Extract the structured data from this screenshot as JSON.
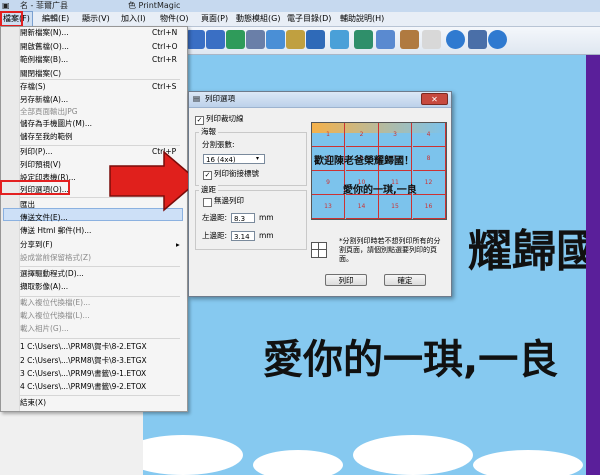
{
  "window": {
    "title_left": "名 - 菲爾广县",
    "title_app": "色 PrintMagic"
  },
  "menubar": [
    "檔案(F)",
    "編輯(E)",
    "顯示(V)",
    "加入(I)",
    "物件(O)",
    "頁面(P)",
    "動態模組(G)",
    "電子目錄(D)",
    "輔助說明(H)"
  ],
  "file_menu": {
    "items": [
      {
        "label": "開新檔案(N)...",
        "shortcut": "Ctrl+N"
      },
      {
        "label": "開啟舊檔(O)...",
        "shortcut": "Ctrl+O"
      },
      {
        "label": "範例檔案(B)...",
        "shortcut": "Ctrl+R"
      },
      {
        "label": "關閉檔案(C)",
        "shortcut": ""
      },
      {
        "label": "存檔(S)",
        "shortcut": "Ctrl+S"
      },
      {
        "label": "另存新檔(A)...",
        "shortcut": ""
      },
      {
        "label": "全部頁面輸出JPG",
        "shortcut": ""
      },
      {
        "label": "儲存為手機圖片(M)...",
        "shortcut": ""
      },
      {
        "label": "儲存至我的範例",
        "shortcut": ""
      },
      {
        "label": "列印(P)...",
        "shortcut": "Ctrl+P"
      },
      {
        "label": "列印預視(V)",
        "shortcut": ""
      },
      {
        "label": "設定印表機(R)...",
        "shortcut": ""
      },
      {
        "label": "列印選項(O)...",
        "shortcut": ""
      },
      {
        "label": "匯出",
        "shortcut": ""
      },
      {
        "label": "傳送文件(E)...",
        "shortcut": ""
      },
      {
        "label": "傳送 Html 郵件(H)...",
        "shortcut": ""
      },
      {
        "label": "分享到(F)",
        "shortcut": "▸"
      },
      {
        "label": "設成當前保留格式(Z)",
        "shortcut": ""
      },
      {
        "label": "選擇驅動程式(D)...",
        "shortcut": ""
      },
      {
        "label": "擷取影像(A)...",
        "shortcut": ""
      },
      {
        "label": "載入複位代換檔(E)...",
        "shortcut": ""
      },
      {
        "label": "載入複位代換檔(L)...",
        "shortcut": ""
      },
      {
        "label": "載入相片(G)...",
        "shortcut": ""
      },
      {
        "label": "1 C:\\Users\\...\\PRM8\\賀卡\\8-2.ETGX",
        "shortcut": ""
      },
      {
        "label": "2 C:\\Users\\...\\PRM8\\賀卡\\8-3.ETGX",
        "shortcut": ""
      },
      {
        "label": "3 C:\\Users\\...\\PRM9\\書籤\\9-1.ETOX",
        "shortcut": ""
      },
      {
        "label": "4 C:\\Users\\...\\PRM9\\書籤\\9-2.ETOX",
        "shortcut": ""
      },
      {
        "label": "結束(X)",
        "shortcut": ""
      }
    ]
  },
  "dialog": {
    "title": "列印選項",
    "close": "✕",
    "print_crop_marks": "列印裁切線",
    "poster_group": "海報",
    "split_label": "分割張數:",
    "split_value": "16 (4x4)",
    "print_joint_marks": "列印銜接標號",
    "margin_group": "邊距",
    "borderless": "無邊列印",
    "left_margin_label": "左邊距:",
    "left_margin_value": "8.3",
    "top_margin_label": "上邊距:",
    "top_margin_value": "3.14",
    "unit": "mm",
    "note": "*分割列印時若不想列印所有的分割頁面，請個別點選要列印的頁面。",
    "print_button": "列印",
    "ok_button": "確定",
    "preview_title": "歡迎陳老爸榮耀歸國！",
    "preview_sub": "愛你的一琪,一良",
    "preview_numbers": [
      "1",
      "2",
      "3",
      "4",
      "5",
      "6",
      "7",
      "8",
      "9",
      "10",
      "11",
      "12",
      "13",
      "14",
      "15",
      "16"
    ]
  },
  "canvas": {
    "headline_fragment": "耀歸國！",
    "subline": "愛你的一琪,一良"
  },
  "colors": {
    "canvas_sky": "#86c9f0",
    "canvas_border": "#5a1f9a",
    "highlight_red": "#e32020",
    "arrow_red": "#e0201c"
  }
}
